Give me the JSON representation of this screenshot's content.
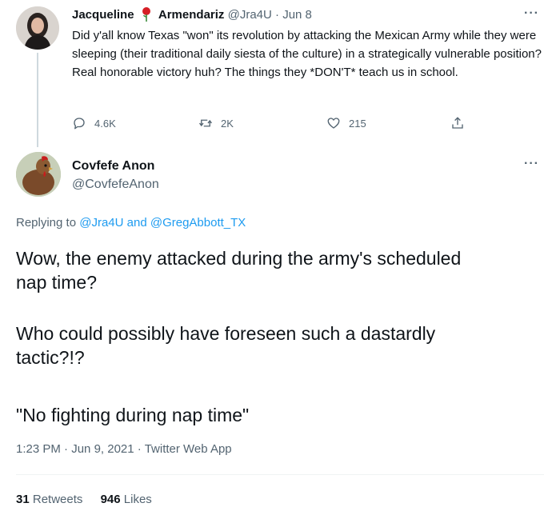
{
  "parent_tweet": {
    "name_first": "Jacqueline",
    "name_last": "Armendariz",
    "handle": "@Jra4U",
    "separator": "·",
    "date": "Jun 8",
    "more": "···",
    "text": "Did y'all know Texas \"won\" its revolution by attacking the Mexican Army while they were sleeping  (their traditional daily siesta of the culture) in a strategically vulnerable position? Real honorable victory huh? The things they *DON'T* teach us in school.",
    "replies": "4.6K",
    "retweets": "2K",
    "likes": "215",
    "icons": [
      "reply-icon",
      "retweet-icon",
      "like-icon",
      "share-icon",
      "rose-icon"
    ]
  },
  "main_tweet": {
    "name": "Covfefe Anon",
    "handle": "@CovfefeAnon",
    "more": "···",
    "replying_prefix": "Replying to",
    "replying_to_1": "@Jra4U",
    "replying_and": "and",
    "replying_to_2": "@GregAbbott_TX",
    "lines": [
      "Wow, the enemy attacked during the army's scheduled",
      "nap time?",
      "Who could possibly have foreseen such a dastardly",
      "tactic?!?",
      "\"No fighting during nap time\""
    ],
    "time": "1:23 PM",
    "date": "Jun 9, 2021",
    "source": "Twitter Web App",
    "dot": "·",
    "retweets_count": "31",
    "retweets_label": "Retweets",
    "likes_count": "946",
    "likes_label": "Likes"
  },
  "colors": {
    "link": "#1d9bf0",
    "muted": "#536471",
    "rose": "#d61f26"
  }
}
